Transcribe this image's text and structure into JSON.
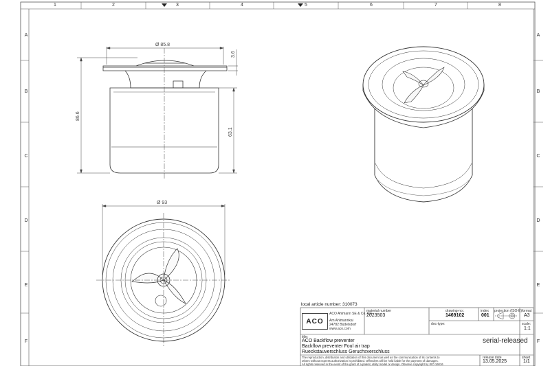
{
  "frame": {
    "columns": [
      "1",
      "2",
      "3",
      "4",
      "5",
      "6",
      "7",
      "8"
    ],
    "rows": [
      "A",
      "B",
      "C",
      "D",
      "E",
      "F"
    ]
  },
  "dimensions": {
    "top_diameter": "Ø 85.8",
    "flange_height": "3.6",
    "total_height": "86.6",
    "body_height": "63.1",
    "base_diameter": "Ø 93"
  },
  "title_block": {
    "local_article": "local article number: 310073",
    "company_name": "ACO Ahlmann SE & Co. KG",
    "company_street": "Am Ahlmannkai",
    "company_city": "24782 Büdelsdorf",
    "company_web": "www.aco.com",
    "logo_text": "ACO",
    "material_number_label": "material number",
    "material_number": "2023503",
    "drawing_no_label": "drawing-no.:",
    "drawing_no": "1469102",
    "index_label": "index",
    "index": "001",
    "projection_label": "projection (ISO-E)",
    "format_label": "format",
    "format": "A3",
    "scale_label": "scale:",
    "scale": "1:1",
    "doc_type_label": "doc-type:",
    "title_label": "title:",
    "title_line1": "ACO Backflow preventer",
    "title_line2": "Backflow preventer Foul air trap",
    "title_line3": "Rueckstauverschluss Geruchsverschluss",
    "status": "serial-released",
    "legal_line1": "The reproduction, distribution and utilization of this document as well as the communication of its contents to",
    "legal_line2": "others without express authorization is prohibited. Offenders will be held liable for the payment of damages.",
    "legal_line3": "All rights reserved in the event of the grant of a patent, utility model or design. Observe copyright by ISO 16016",
    "release_date_label": "release date",
    "release_date": "13.05.2025",
    "sheet_label": "sheet",
    "sheet": "1/1"
  }
}
